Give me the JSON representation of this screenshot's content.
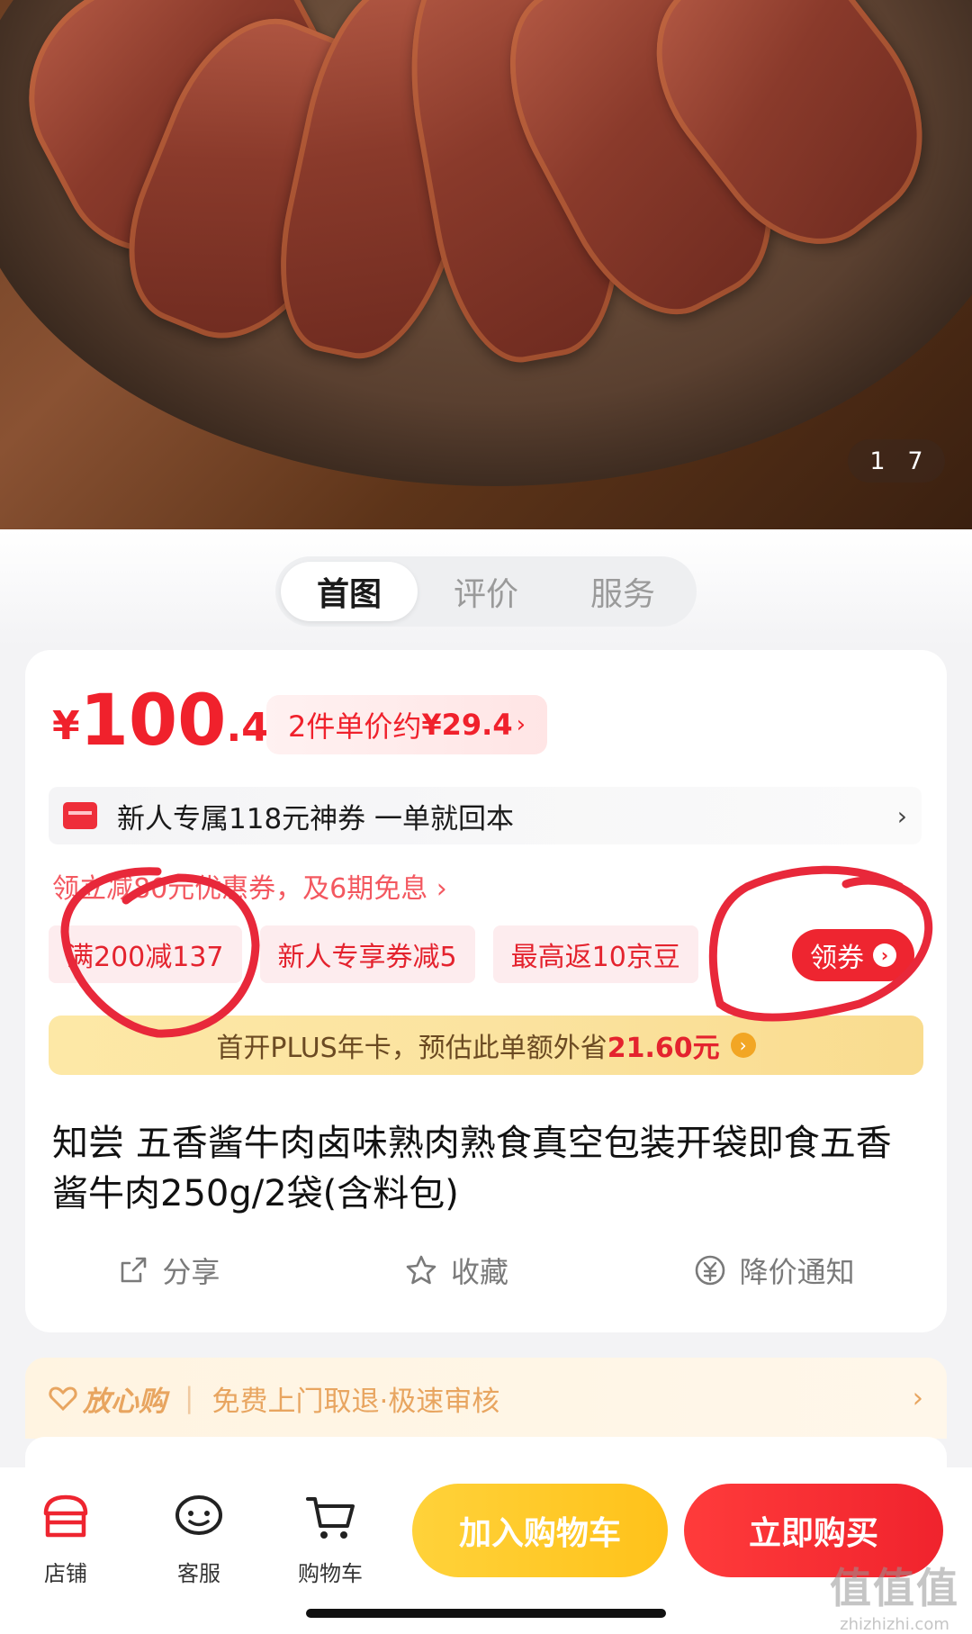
{
  "gallery": {
    "index": "1",
    "total": "7"
  },
  "tabs": [
    {
      "label": "首图"
    },
    {
      "label": "评价"
    },
    {
      "label": "服务"
    }
  ],
  "price": {
    "currency": "¥",
    "integer": "100",
    "decimal": ".40",
    "unit_price_prefix": "2件单价约",
    "unit_price_value": "¥29.4",
    "unit_price_arrow": "›"
  },
  "new_user_banner": {
    "text": "新人专属118元神券 一单就回本",
    "arrow": "›"
  },
  "coupon_line": "领立减80元优惠券，及6期免息 ›",
  "chips": [
    {
      "label": "满200减137"
    },
    {
      "label": "新人专享券减5"
    },
    {
      "label": "最高返10京豆"
    }
  ],
  "get_coupon": {
    "label": "领券",
    "arrow": "›"
  },
  "plus_banner": {
    "prefix": "首开PLUS年卡，预估此单额外省",
    "amount": "21.60元",
    "arrow": "›"
  },
  "product_title": "知尝 五香酱牛肉卤味熟肉熟食真空包装开袋即食五香酱牛肉250g/2袋(含料包)",
  "actions": [
    {
      "label": "分享"
    },
    {
      "label": "收藏"
    },
    {
      "label": "降价通知"
    }
  ],
  "assurance": {
    "brand": "放心购",
    "text": "免费上门取退·极速审核",
    "arrow": "›"
  },
  "bottom_nav": [
    {
      "label": "店铺",
      "icon": "store-icon"
    },
    {
      "label": "客服",
      "icon": "chat-icon"
    },
    {
      "label": "购物车",
      "icon": "cart-icon"
    }
  ],
  "buttons": {
    "add_to_cart": "加入购物车",
    "buy_now": "立即购买"
  },
  "watermark": {
    "main": "值值值",
    "url": "zhizhizhi.com"
  },
  "colors": {
    "accent_red": "#f0212c",
    "cart_yellow": "#ffc21a",
    "plus_gold": "#fde8a6",
    "annotation_red": "#e8283a"
  }
}
